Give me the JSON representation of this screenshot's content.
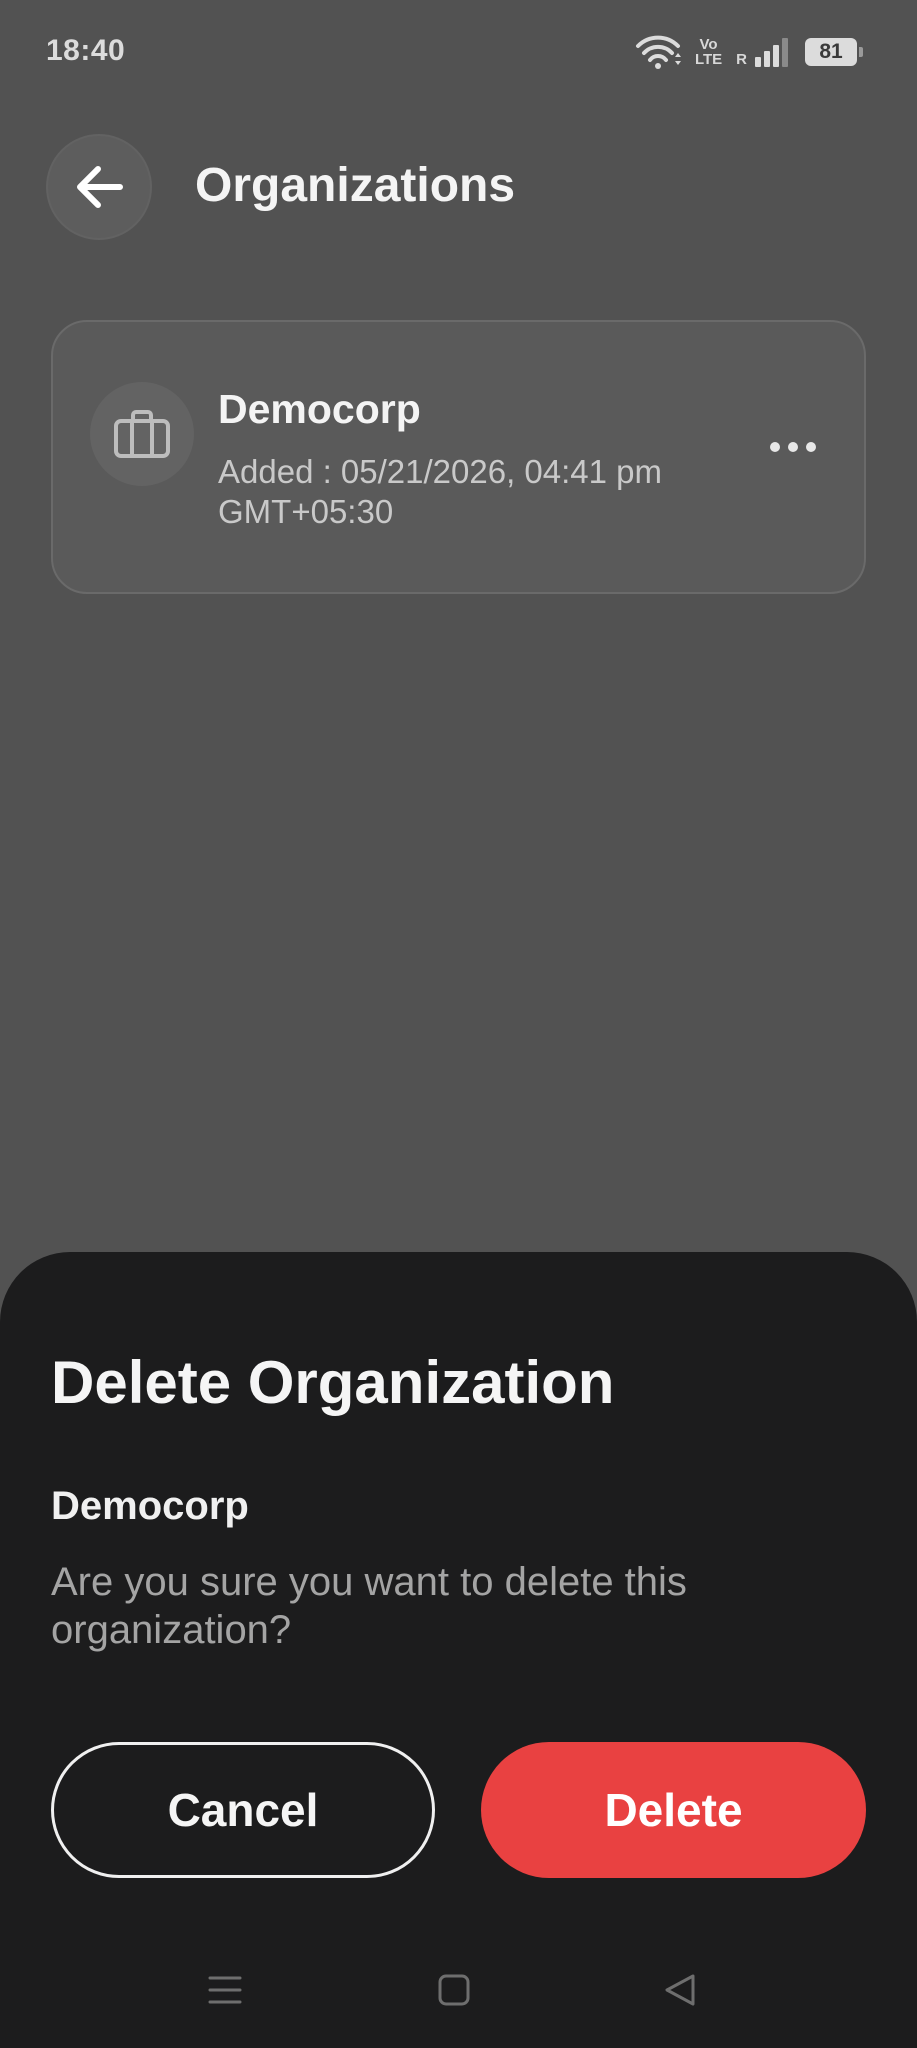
{
  "status_bar": {
    "time": "18:40",
    "volte_top": "Vo",
    "volte_bottom": "LTE",
    "roaming": "R",
    "battery": "81"
  },
  "header": {
    "title": "Organizations",
    "back_icon": "arrow-left-icon"
  },
  "organization": {
    "name": "Democorp",
    "added": "Added : 05/21/2026, 04:41 pm GMT+05:30",
    "icon": "briefcase-icon"
  },
  "dialog": {
    "title": "Delete Organization",
    "org_name": "Democorp",
    "message": "Are you sure you want to delete this organization?",
    "cancel_label": "Cancel",
    "delete_label": "Delete",
    "delete_color": "#e94141"
  },
  "nav_bar": {
    "icons": [
      "menu-icon",
      "home-square-icon",
      "back-triangle-icon"
    ]
  }
}
